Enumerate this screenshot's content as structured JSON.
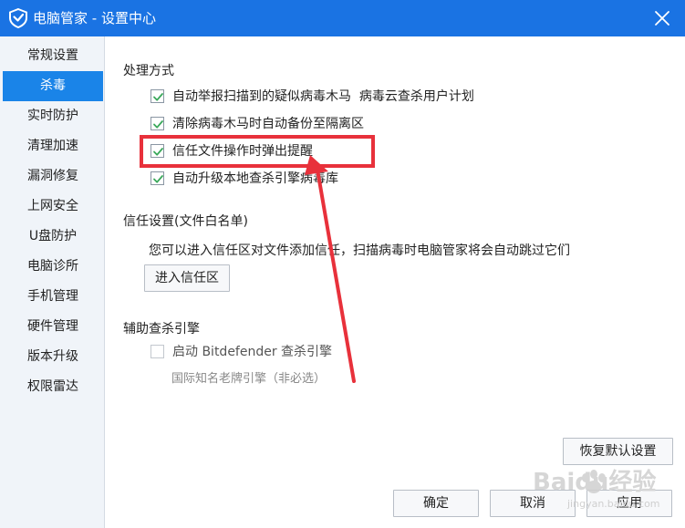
{
  "window": {
    "title": "电脑管家 - 设置中心",
    "logo_icon": "shield-icon",
    "close_icon": "close-icon",
    "accent": "#1a73e3"
  },
  "sidebar": {
    "items": [
      {
        "label": "常规设置",
        "active": false
      },
      {
        "label": "杀毒",
        "active": true
      },
      {
        "label": "实时防护",
        "active": false
      },
      {
        "label": "清理加速",
        "active": false
      },
      {
        "label": "漏洞修复",
        "active": false
      },
      {
        "label": "上网安全",
        "active": false
      },
      {
        "label": "U盘防护",
        "active": false
      },
      {
        "label": "电脑诊所",
        "active": false
      },
      {
        "label": "手机管理",
        "active": false
      },
      {
        "label": "硬件管理",
        "active": false
      },
      {
        "label": "版本升级",
        "active": false
      },
      {
        "label": "权限雷达",
        "active": false
      }
    ]
  },
  "processing": {
    "title": "处理方式",
    "options": [
      {
        "label": "自动举报扫描到的疑似病毒木马",
        "checked": true,
        "link": "病毒云查杀用户计划"
      },
      {
        "label": "清除病毒木马时自动备份至隔离区",
        "checked": true
      },
      {
        "label": "信任文件操作时弹出提醒",
        "checked": true,
        "highlighted": true
      },
      {
        "label": "自动升级本地查杀引擎病毒库",
        "checked": true
      }
    ]
  },
  "trust": {
    "title": "信任设置(文件白名单)",
    "description": "您可以进入信任区对文件添加信任，扫描病毒时电脑管家将会自动跳过它们",
    "button": "进入信任区"
  },
  "engine": {
    "title": "辅助查杀引擎",
    "option": {
      "label": "启动 Bitdefender 查杀引擎",
      "checked": false
    },
    "note": "国际知名老牌引擎（非必选）"
  },
  "footer": {
    "restore": "恢复默认设置",
    "ok": "确定",
    "cancel": "取消",
    "apply": "应用"
  },
  "annotation": {
    "color": "#e8313b"
  },
  "watermark": {
    "brand": "Baidu经验",
    "url": "jingyan.baidu.com"
  }
}
